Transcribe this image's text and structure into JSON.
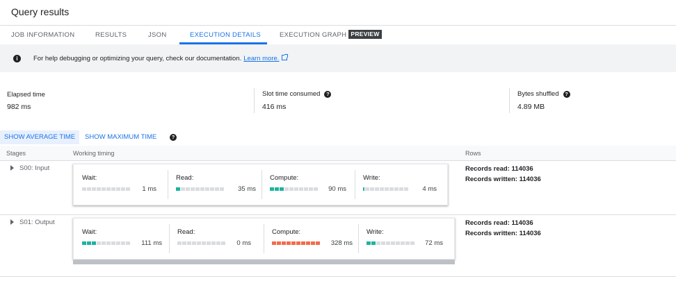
{
  "page": {
    "title": "Query results"
  },
  "tabs": [
    {
      "label": "JOB INFORMATION"
    },
    {
      "label": "RESULTS"
    },
    {
      "label": "JSON"
    },
    {
      "label": "EXECUTION DETAILS",
      "active": true
    },
    {
      "label": "EXECUTION GRAPH",
      "badge": "PREVIEW"
    }
  ],
  "info_bar": {
    "icon": "info-icon",
    "text": "For help debugging or optimizing your query, check our documentation.",
    "link_text": "Learn more."
  },
  "stats": [
    {
      "label": "Elapsed time",
      "value": "982 ms"
    },
    {
      "label": "Slot time consumed",
      "value": "416 ms",
      "help": "?"
    },
    {
      "label": "Bytes shuffled",
      "value": "4.89 MB",
      "help": "?"
    }
  ],
  "time_toggle": {
    "average": "SHOW AVERAGE TIME",
    "maximum": "SHOW MAXIMUM TIME",
    "help": "?",
    "selected": "average"
  },
  "table": {
    "headers": {
      "stages": "Stages",
      "working_timing": "Working timing",
      "rows": "Rows"
    },
    "stages": [
      {
        "name": "S00: Input",
        "timings": [
          {
            "label": "Wait:",
            "value": "1 ms",
            "fraction": 0.0,
            "color": "#1db39e"
          },
          {
            "label": "Read:",
            "value": "35 ms",
            "fraction": 0.1,
            "color": "#1db39e"
          },
          {
            "label": "Compute:",
            "value": "90 ms",
            "fraction": 0.3,
            "color": "#1db39e"
          },
          {
            "label": "Write:",
            "value": "4 ms",
            "fraction": 0.02,
            "color": "#1db39e"
          }
        ],
        "rows": {
          "read": "Records read: 114036",
          "written": "Records written: 114036"
        }
      },
      {
        "name": "S01: Output",
        "timings": [
          {
            "label": "Wait:",
            "value": "111 ms",
            "fraction": 0.3,
            "color": "#1db39e"
          },
          {
            "label": "Read:",
            "value": "0 ms",
            "fraction": 0.0,
            "color": "#1db39e"
          },
          {
            "label": "Compute:",
            "value": "328 ms",
            "fraction": 1.0,
            "color": "#f26c4f"
          },
          {
            "label": "Write:",
            "value": "72 ms",
            "fraction": 0.2,
            "color": "#1db39e"
          }
        ],
        "rows": {
          "read": "Records read: 114036",
          "written": "Records written: 114036"
        }
      }
    ]
  }
}
